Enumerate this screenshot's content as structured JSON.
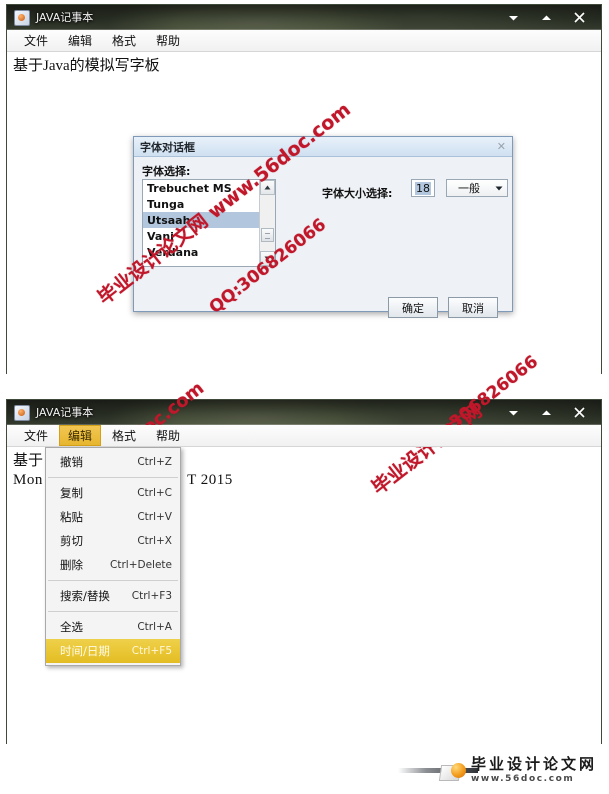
{
  "page": {
    "background": "#ffffff",
    "watermark_color": "#c0172a",
    "accent_menu_highlight": "#e7b62f",
    "list_selection_color": "#b2c7dd"
  },
  "window_top": {
    "title": "JAVA记事本",
    "icon": "app-icon",
    "controls": {
      "minimize": "minimize-icon",
      "maximize": "maximize-icon",
      "close": "close-icon"
    },
    "menubar": [
      {
        "label": "文件"
      },
      {
        "label": "编辑"
      },
      {
        "label": "格式"
      },
      {
        "label": "帮助"
      }
    ],
    "content_lines": [
      "基于Java的模拟写字板"
    ]
  },
  "font_dialog": {
    "title": "字体对话框",
    "close_label": "✕",
    "font_select_label": "字体选择:",
    "font_list": [
      {
        "name": "Trebuchet MS",
        "selected": false
      },
      {
        "name": "Tunga",
        "selected": false
      },
      {
        "name": "Utsaah",
        "selected": true
      },
      {
        "name": "Vani",
        "selected": false
      },
      {
        "name": "Verdana",
        "selected": false
      }
    ],
    "size_label": "字体大小选择:",
    "size_value": "18",
    "style_value": "一般",
    "buttons": {
      "ok": "确定",
      "cancel": "取消"
    }
  },
  "window_bottom": {
    "title": "JAVA记事本",
    "icon": "app-icon",
    "controls": {
      "minimize": "minimize-icon",
      "maximize": "maximize-icon",
      "close": "close-icon"
    },
    "menubar": [
      {
        "label": "文件",
        "open": false
      },
      {
        "label": "编辑",
        "open": true
      },
      {
        "label": "格式",
        "open": false
      },
      {
        "label": "帮助",
        "open": false
      }
    ],
    "content_lines": [
      "基于",
      "Mon "
    ],
    "content_line2_tail": "T 2015",
    "edit_menu": [
      {
        "label": "撤销",
        "accel": "Ctrl+Z",
        "highlight": false,
        "separator_after": true
      },
      {
        "label": "复制",
        "accel": "Ctrl+C",
        "highlight": false,
        "separator_after": false
      },
      {
        "label": "粘贴",
        "accel": "Ctrl+V",
        "highlight": false,
        "separator_after": false
      },
      {
        "label": "剪切",
        "accel": "Ctrl+X",
        "highlight": false,
        "separator_after": false
      },
      {
        "label": "删除",
        "accel": "Ctrl+Delete",
        "highlight": false,
        "separator_after": true
      },
      {
        "label": "搜索/替换",
        "accel": "Ctrl+F3",
        "highlight": false,
        "separator_after": true
      },
      {
        "label": "全选",
        "accel": "Ctrl+A",
        "highlight": false,
        "separator_after": false
      },
      {
        "label": "时间/日期",
        "accel": "Ctrl+F5",
        "highlight": true,
        "separator_after": false
      }
    ]
  },
  "watermarks": [
    {
      "text": "毕业设计论文网 www.56doc.com"
    },
    {
      "text": "QQ:306826066"
    },
    {
      "text": "www.56doc.com"
    },
    {
      "text": "毕业设计论文网"
    },
    {
      "text": "QQ:306826066"
    }
  ],
  "footer": {
    "cn": "毕业设计论文网",
    "en": "www.56doc.com",
    "logo": "graduation-paper-logo"
  }
}
